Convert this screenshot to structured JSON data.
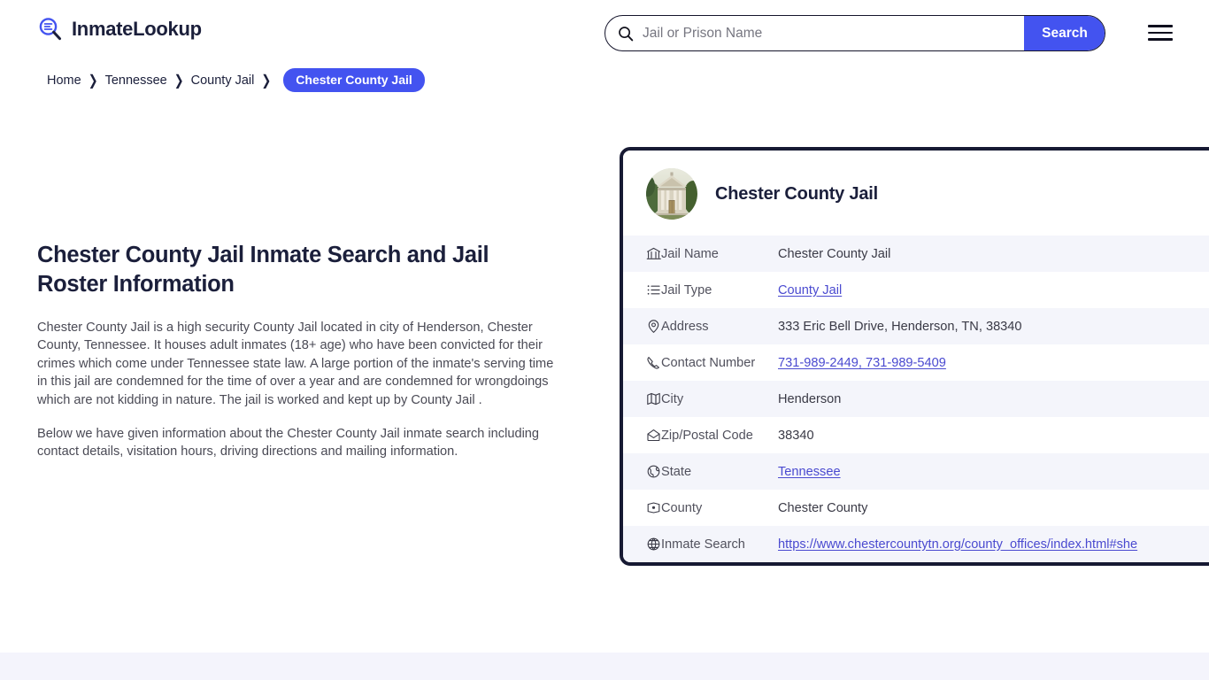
{
  "header": {
    "brand_name": "InmateLookup",
    "brand_icon": "magnifier-list-icon",
    "search": {
      "placeholder": "Jail or Prison Name",
      "value": "",
      "icon": "search-icon",
      "button_label": "Search"
    },
    "menu_icon": "hamburger-menu-icon"
  },
  "breadcrumb": {
    "items": [
      {
        "label": "Home"
      },
      {
        "label": "Tennessee"
      },
      {
        "label": "County Jail"
      }
    ],
    "separator": "❯",
    "current": "Chester County Jail"
  },
  "main": {
    "title": "Chester County Jail Inmate Search and Jail Roster Information",
    "paragraphs": [
      "Chester County Jail is a high security County Jail located in city of Henderson, Chester County, Tennessee. It houses adult inmates (18+ age) who have been convicted for their crimes which come under Tennessee state law. A large portion of the inmate's serving time in this jail are condemned for the time of over a year and are condemned for wrongdoings which are not kidding in nature. The jail is worked and kept up by County Jail .",
      "Below we have given information about the Chester County Jail inmate search including contact details, visitation hours, driving directions and mailing information."
    ]
  },
  "card": {
    "avatar_icon": "courthouse-photo",
    "title": "Chester County Jail",
    "rows": [
      {
        "icon": "bank-icon",
        "label": "Jail Name",
        "value": "Chester County Jail",
        "link": false
      },
      {
        "icon": "list-icon",
        "label": "Jail Type",
        "value": "County Jail",
        "link": true
      },
      {
        "icon": "map-pin-icon",
        "label": "Address",
        "value": "333 Eric Bell Drive, Henderson, TN, 38340",
        "link": false
      },
      {
        "icon": "phone-icon",
        "label": "Contact Number",
        "value": "731-989-2449, 731-989-5409",
        "link": true
      },
      {
        "icon": "map-icon",
        "label": "City",
        "value": "Henderson",
        "link": false
      },
      {
        "icon": "envelope-icon",
        "label": "Zip/Postal Code",
        "value": "38340",
        "link": false
      },
      {
        "icon": "globe-icon",
        "label": "State",
        "value": "Tennessee",
        "link": true
      },
      {
        "icon": "map-point-icon",
        "label": "County",
        "value": "Chester County",
        "link": false
      },
      {
        "icon": "web-globe-icon",
        "label": "Inmate Search",
        "value": "https://www.chestercountytn.org/county_offices/index.html#she",
        "link": true
      }
    ]
  },
  "colors": {
    "accent": "#4353f0",
    "dark": "#171a33",
    "link": "#4a4ad0",
    "row_alt": "#f4f5fb",
    "footer_band": "#f4f4fc"
  }
}
